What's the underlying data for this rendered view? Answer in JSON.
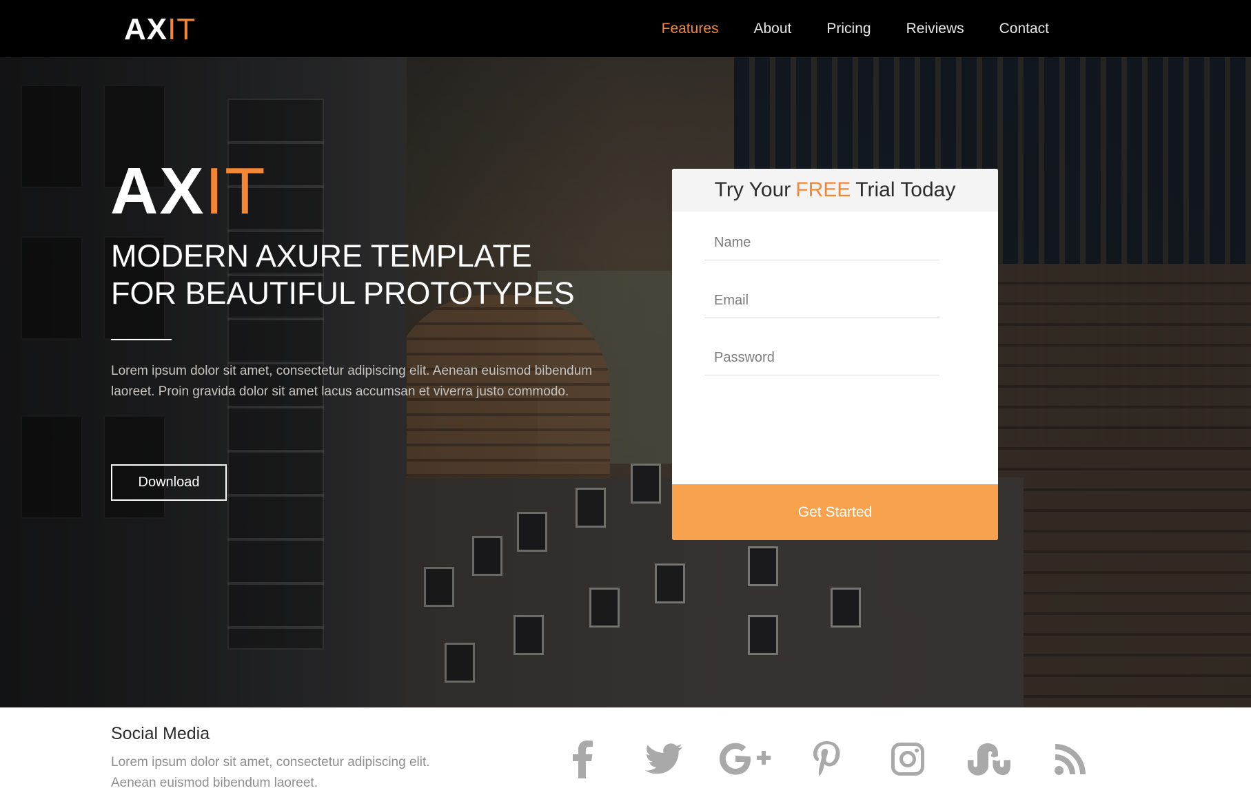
{
  "brand": {
    "logo_main": "AX",
    "logo_accent": "IT"
  },
  "nav": {
    "items": [
      {
        "label": "Features",
        "active": true
      },
      {
        "label": "About"
      },
      {
        "label": "Pricing"
      },
      {
        "label": "Reiviews"
      },
      {
        "label": "Contact"
      }
    ]
  },
  "hero": {
    "logo_main": "AX",
    "logo_accent": "IT",
    "title_line1": "MODERN AXURE TEMPLATE",
    "title_line2": "FOR BEAUTIFUL PROTOTYPES",
    "text": "Lorem ipsum dolor sit amet, consectetur adipiscing elit. Aenean euismod bibendum laoreet. Proin gravida dolor sit amet lacus accumsan et viverra justo commodo.",
    "download_label": "Download"
  },
  "signup": {
    "title_pre": "Try Your",
    "title_accent": "FREE",
    "title_post": "Trial Today",
    "name_placeholder": "Name",
    "email_placeholder": "Email",
    "password_placeholder": "Password",
    "submit_label": "Get Started"
  },
  "social": {
    "title": "Social Media",
    "text": "Lorem ipsum dolor sit amet, consectetur adipiscing elit. Aenean euismod bibendum laoreet.",
    "icons": [
      "facebook-icon",
      "twitter-icon",
      "google-plus-icon",
      "pinterest-icon",
      "instagram-icon",
      "stumbleupon-icon",
      "rss-icon"
    ]
  },
  "colors": {
    "accent": "#f58634",
    "button": "#f9a24e",
    "nav_bg": "#000000",
    "icon_gray": "#a9a9a9"
  }
}
